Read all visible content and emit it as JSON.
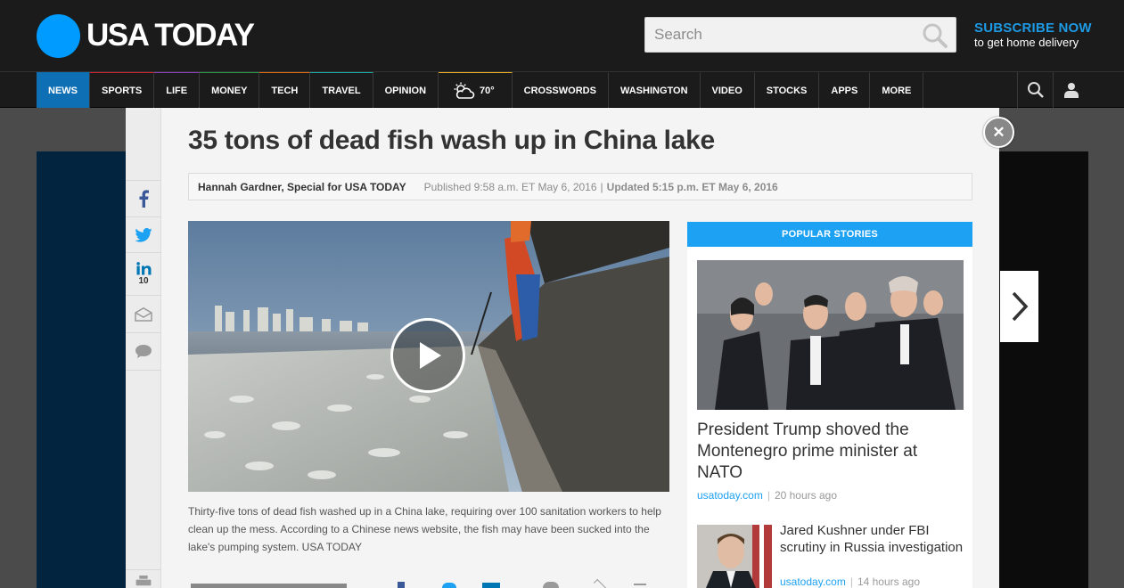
{
  "header": {
    "logo": "USA TODAY",
    "search_placeholder": "Search",
    "subscribe_title": "SUBSCRIBE NOW",
    "subscribe_sub": "to get home delivery"
  },
  "nav": {
    "items": [
      {
        "label": "NEWS"
      },
      {
        "label": "SPORTS"
      },
      {
        "label": "LIFE"
      },
      {
        "label": "MONEY"
      },
      {
        "label": "TECH"
      },
      {
        "label": "TRAVEL"
      },
      {
        "label": "OPINION"
      },
      {
        "label": "70°",
        "icon": "partly-cloudy-icon"
      },
      {
        "label": "CROSSWORDS"
      },
      {
        "label": "WASHINGTON"
      },
      {
        "label": "VIDEO"
      },
      {
        "label": "STOCKS"
      },
      {
        "label": "APPS"
      },
      {
        "label": "MORE"
      }
    ],
    "active": "NEWS"
  },
  "article": {
    "headline": "35 tons of dead fish wash up in China lake",
    "author": "Hannah Gardner, Special for USA TODAY",
    "published": "Published 9:58 a.m. ET May 6, 2016",
    "separator": "|",
    "updated": "Updated 5:15 p.m. ET May 6, 2016",
    "caption": "Thirty-five tons of dead fish washed up in a China lake, requiring over 100 sanitation workers to help clean up the mess. According to a Chinese news website, the fish may have been sucked into the lake's pumping system. USA TODAY"
  },
  "share": {
    "linkedin_count": "10"
  },
  "popular": {
    "heading": "POPULAR STORIES",
    "stories": [
      {
        "title": "President Trump shoved the Montenegro prime minister at NATO",
        "source": "usatoday.com",
        "time": "20 hours ago"
      },
      {
        "title": "Jared Kushner under FBI scrutiny in Russia investigation",
        "source": "usatoday.com",
        "time": "14 hours ago"
      }
    ]
  },
  "colors": {
    "brand_blue": "#009bff",
    "nav_active": "#0f6fb5",
    "popular_header": "#1da1f2",
    "header_bg": "#1b1b1b"
  }
}
